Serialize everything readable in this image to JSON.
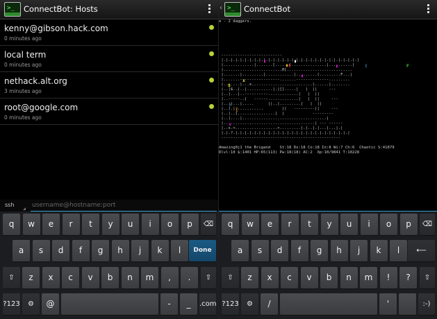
{
  "left": {
    "title": "ConnectBot: Hosts",
    "hosts": [
      {
        "name": "kenny@gibson.hack.com",
        "time": "0 minutes ago"
      },
      {
        "name": "local term",
        "time": "0 minutes ago"
      },
      {
        "name": "nethack.alt.org",
        "time": "3 minutes ago"
      },
      {
        "name": "root@google.com",
        "time": "0 minutes ago"
      }
    ],
    "status_color": "#b5d334",
    "quick_connect": {
      "protocol": "ssh",
      "placeholder": "username@hostname:port"
    },
    "keyboard": {
      "row1": [
        "q",
        "w",
        "e",
        "r",
        "t",
        "y",
        "u",
        "i",
        "o",
        "p"
      ],
      "row2": [
        "a",
        "s",
        "d",
        "f",
        "g",
        "h",
        "j",
        "k",
        "l"
      ],
      "done_label": "Done",
      "row3": [
        "z",
        "x",
        "c",
        "v",
        "b",
        "n",
        "m",
        ",",
        "."
      ],
      "sym_label": "?123",
      "at_label": "@",
      "dash_label": "-",
      "underscore_label": "_",
      "com_label": ".com"
    }
  },
  "right": {
    "title": "ConnectBot",
    "terminal": {
      "message": "e - 2 daggers.",
      "status1": "Amazing0j1 the Brigand    St:18 Dx:18 Co:18 In:8 Wi:7 Ch:6  Chaotic S:41879",
      "status2": "Dlvl:10 $:1401 HP:65(113) Pw:18(18) AC:2  Xp:10/9841 T:10228",
      "map": [
        "",
        "",
        "",
        "",
        "",
        "",
        "",
        " --------------------------",
        " |.|.|.|.|.|.|.|.|.|.|.|.|.|.|.|.|.|.|.|.|.|.|.|.|.|.|.|.|.|",
        " |.............|.......[......|...............|..........|",
        " |.........................0[............................",
        " |.......|.........|............|.........(.........F...|",
        " |.......-----------------.......--------------.........",
        " |.......|...x..........................|......|........",
        " |..|$..|..|...........|.|[].....|   |  ||     ---",
        " |..|...|..----------.............|   |  ||",
        " |..-----..|   ------.............|   |  ||     ---",
        " |...|...|.....      ||..|.........|   |  ||",
        " |..).|............        ||   ---------||     ---",
        " |..|..[................|  |            ---------",
        " |..|....|....................................|",
        " |.......................................| --- ------",
        " |..s.<..................>.........|.|..|.|...|...|.|",
        " |.|.?.|.|.|.|.|.|.|.|.|.|.|.|.|.|.|.|.|.|.|.|.|.|.|.|.|",
        " ---------------------------------------------------"
      ]
    },
    "keyboard": {
      "row1": [
        "q",
        "w",
        "e",
        "r",
        "t",
        "y",
        "u",
        "i",
        "o",
        "p"
      ],
      "row2": [
        "a",
        "s",
        "d",
        "f",
        "g",
        "h",
        "j",
        "k",
        "l"
      ],
      "row3": [
        "z",
        "x",
        "c",
        "v",
        "b",
        "n",
        "m",
        "!",
        "?"
      ],
      "sym_label": "?123",
      "slash_label": "/",
      "apostrophe_label": "'",
      "smiley_label": ":-)"
    }
  },
  "icons": [
    "app-terminal-icon",
    "overflow-menu-icon",
    "backspace-icon",
    "shift-icon",
    "settings-icon",
    "enter-icon",
    "status-dot-icon"
  ]
}
